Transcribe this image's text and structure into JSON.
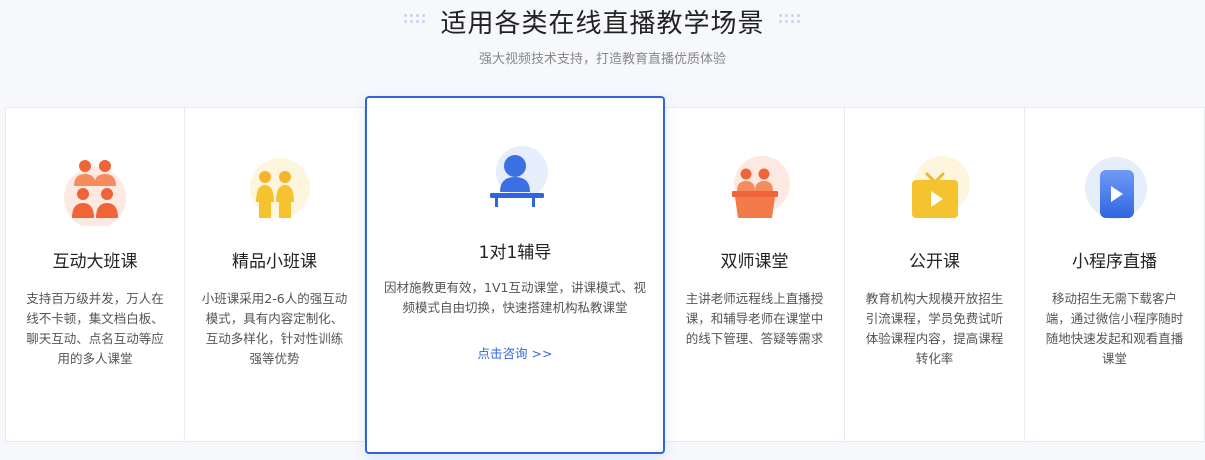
{
  "header": {
    "title": "适用各类在线直播教学场景",
    "subtitle": "强大视频技术支持，打造教育直播优质体验"
  },
  "cards": [
    {
      "name": "互动大班课",
      "desc": "支持百万级并发，万人在线不卡顿，集文档白板、聊天互动、点名互动等应用的多人课堂",
      "icon": "group-people-icon"
    },
    {
      "name": "精品小班课",
      "desc": "小班课采用2-6人的强互动模式，具有内容定制化、互动多样化，针对性训练强等优势",
      "icon": "small-group-icon"
    },
    {
      "name": "1对1辅导",
      "desc": "因材施教更有效，1V1互动课堂，讲课模式、视频模式自由切换，快速搭建机构私教课堂",
      "cta": "点击咨询 >>",
      "icon": "tutor-desk-icon"
    },
    {
      "name": "双师课堂",
      "desc": "主讲老师远程线上直播授课，和辅导老师在课堂中的线下管理、答疑等需求",
      "icon": "dual-teacher-icon"
    },
    {
      "name": "公开课",
      "desc": "教育机构大规模开放招生引流课程，学员免费试听体验课程内容，提高课程转化率",
      "icon": "tv-play-icon"
    },
    {
      "name": "小程序直播",
      "desc": "移动招生无需下载客户端，通过微信小程序随时随地快速发起和观看直播课堂",
      "icon": "mini-program-play-icon"
    }
  ],
  "colors": {
    "accent": "#2f66e0",
    "orange": "#f0643a",
    "yellow": "#f5c230"
  }
}
